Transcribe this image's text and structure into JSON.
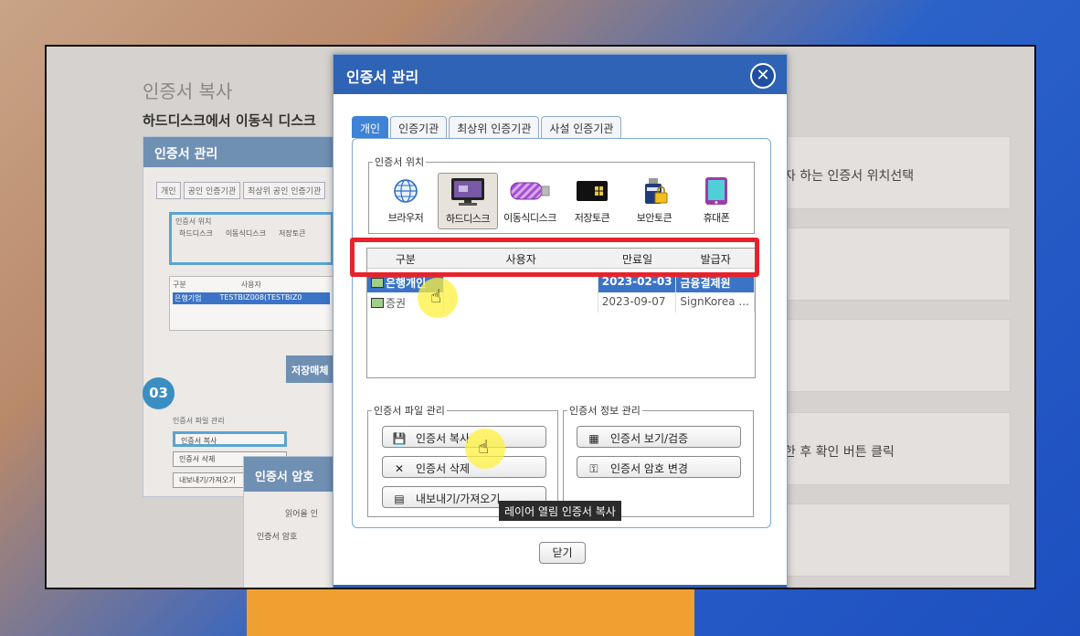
{
  "background": {
    "page_title": "인증서 복사",
    "subtitle": "하드디스크에서 이동식 디스크",
    "panel_title": "인증서 관리",
    "panel_tabs": [
      "개인",
      "공인 인증기관",
      "최상위 공인 인증기관"
    ],
    "panel_location_label": "인증서 위치",
    "panel_locations": [
      "하드디스크",
      "이동식디스크",
      "저장토큰"
    ],
    "panel_list_cols": [
      "구분",
      "사용자"
    ],
    "panel_list_row": [
      "은행기업",
      "TESTBIZ008(TESTBIZ0"
    ],
    "panel_file_mgmt": "인증서 파일 관리",
    "panel_btn_copy": "인증서 복사",
    "panel_btn_delete": "인증서 삭제",
    "panel_btn_export": "내보내기/가져오기",
    "step_badge": "03",
    "storage_title": "저장매체",
    "password_title": "인증서 암호",
    "password_label": "인증서 암호",
    "read_label": "읽어올 인",
    "right_texts": [
      "자 하는 인증서 위치선택",
      "한 후 확인 버튼 클릭"
    ]
  },
  "dialog": {
    "title": "인증서 관리",
    "tabs": [
      "개인",
      "인증기관",
      "최상위 인증기관",
      "사설 인증기관"
    ],
    "location_legend": "인증서 위치",
    "locations": [
      {
        "label": "브라우저",
        "icon": "globe-icon"
      },
      {
        "label": "하드디스크",
        "icon": "monitor-icon"
      },
      {
        "label": "이동식디스크",
        "icon": "usb-drive-icon"
      },
      {
        "label": "저장토큰",
        "icon": "smart-token-icon"
      },
      {
        "label": "보안토큰",
        "icon": "secure-token-icon"
      },
      {
        "label": "휴대폰",
        "icon": "phone-icon"
      }
    ],
    "selected_location": "하드디스크",
    "list_headers": [
      "구분",
      "사용자",
      "만료일",
      "발급자"
    ],
    "rows": [
      {
        "type": "은행개인",
        "user": "",
        "expiry": "2023-02-03",
        "issuer": "금융결제원"
      },
      {
        "type": "증권",
        "user": "",
        "expiry": "2023-09-07",
        "issuer": "SignKorea ..."
      }
    ],
    "file_mgmt_legend": "인증서 파일 관리",
    "info_mgmt_legend": "인증서 정보 관리",
    "btn_copy": "인증서 복사",
    "btn_delete": "인증서 삭제",
    "btn_export": "내보내기/가져오기",
    "btn_view": "인증서 보기/검증",
    "btn_change_pw": "인증서 암호 변경",
    "tooltip": "레이어 열림 인증서 복사",
    "close_button": "닫기"
  },
  "colors": {
    "accent_blue": "#2e63b5",
    "selection_blue": "#3b73c6",
    "highlight_red": "#e8222b",
    "cursor_yellow": "#fff03c"
  }
}
